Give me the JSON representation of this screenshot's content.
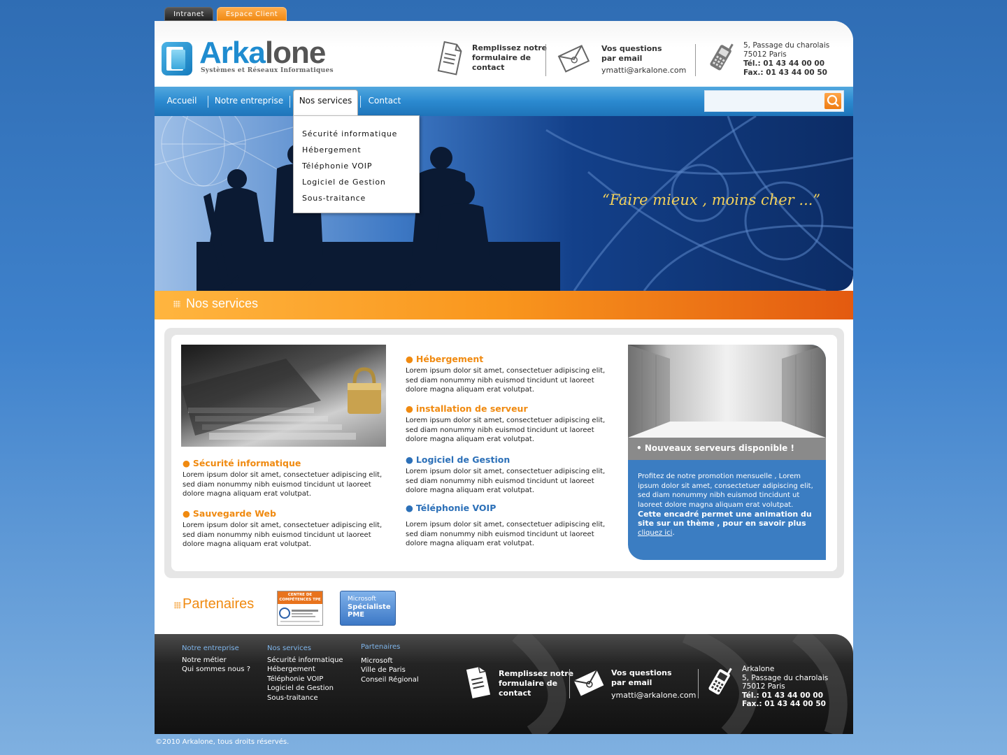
{
  "top_tabs": {
    "intranet": "Intranet",
    "client": "Espace Client"
  },
  "brand": {
    "name_part1": "Arka",
    "name_part2": "lone",
    "tagline": "Systèmes et Réseaux Informatiques"
  },
  "header_contact": {
    "form_line1": "Remplissez notre",
    "form_line2": "formulaire de",
    "form_line3": "contact",
    "email_line1": "Vos questions",
    "email_line2": "par email",
    "email": "ymatti@arkalone.com",
    "address_line1": "5, Passage du charolais",
    "address_line2": "75012 Paris",
    "tel": "Tél.: 01 43 44 00 00",
    "fax": "Fax.: 01 43 44 00 50"
  },
  "nav": {
    "items": [
      "Accueil",
      "Notre entreprise",
      "Nos services",
      "Contact"
    ],
    "active": "Nos services"
  },
  "search": {
    "placeholder": ""
  },
  "dropdown": [
    "Sécurité informatique",
    "Hébergement",
    "Téléphonie VOIP",
    "Logiciel de Gestion",
    "Sous-traitance"
  ],
  "hero": {
    "slogan": "“Faire mieux , moins cher ...”"
  },
  "section": {
    "title": "Nos services"
  },
  "services": {
    "left": [
      {
        "title": "Sécurité informatique",
        "text": "Lorem ipsum dolor sit amet, consectetuer adipiscing elit, sed diam nonummy nibh euismod tincidunt ut laoreet dolore magna aliquam erat volutpat."
      },
      {
        "title": "Sauvegarde Web",
        "text": "Lorem ipsum dolor sit amet, consectetuer adipiscing elit, sed diam nonummy nibh euismod tincidunt ut laoreet dolore magna aliquam erat volutpat."
      }
    ],
    "middle": [
      {
        "title": "Hébergement",
        "text": "Lorem ipsum dolor sit amet, consectetuer adipiscing elit, sed diam nonummy nibh euismod tincidunt ut laoreet dolore magna aliquam erat volutpat."
      },
      {
        "title": "installation de serveur",
        "text": "Lorem ipsum dolor sit amet, consectetuer adipiscing elit, sed diam nonummy nibh euismod tincidunt ut laoreet dolore magna aliquam erat volutpat."
      },
      {
        "title": "Logiciel de Gestion",
        "text": "Lorem ipsum dolor sit amet, consectetuer adipiscing elit, sed diam nonummy nibh euismod tincidunt ut laoreet dolore magna aliquam erat volutpat."
      },
      {
        "title": "Téléphonie VOIP",
        "text": "Lorem ipsum dolor sit amet, consectetuer adipiscing elit, sed diam nonummy nibh euismod tincidunt ut laoreet dolore magna aliquam erat volutpat."
      }
    ]
  },
  "promo": {
    "title": "• Nouveaux serveurs disponible !",
    "text": "Profitez de notre promotion mensuelle , Lorem ipsum dolor sit amet, consectetuer adipiscing elit, sed diam nonummy nibh euismod tincidunt ut laoreet dolore magna aliquam erat volutpat.",
    "strong": "Cette encadré permet une animation du site sur un thème , pour en savoir plus",
    "link": "cliquez ici",
    "period": "."
  },
  "partners": {
    "title": "Partenaires",
    "tpe_line1": "CENTRE DE",
    "tpe_line2": "COMPÉTENCES TPE",
    "ms_line1": "Microsoft",
    "ms_line2": "Spécialiste",
    "ms_line3": "PME"
  },
  "footer": {
    "col1": {
      "head": "Notre entreprise",
      "items": [
        "Notre métier",
        "Qui sommes nous ?"
      ]
    },
    "col2": {
      "head": "Nos services",
      "items": [
        "Sécurité informatique",
        "Hébergement",
        "Téléphonie VOIP",
        "Logiciel de Gestion",
        "Sous-traitance"
      ]
    },
    "col3": {
      "head": "Partenaires",
      "items": [
        "Microsoft",
        "Ville de Paris",
        "Conseil Régional"
      ]
    },
    "form_line1": "Remplissez notre",
    "form_line2": "formulaire de",
    "form_line3": "contact",
    "email_line1": "Vos questions",
    "email_line2": "par email",
    "email": "ymatti@arkalone.com",
    "company": "Arkalone",
    "address_line1": "5, Passage du charolais",
    "address_line2": "75012 Paris",
    "tel": "Tél.: 01 43 44 00 00",
    "fax": "Fax.: 01 43 44 00 50"
  },
  "copyright": "©2010 Arkalone, tous droits réservés.",
  "colors": {
    "brand_blue": "#1f8cd0",
    "accent_orange": "#f08a10",
    "promo_blue": "#3b7dc2"
  }
}
